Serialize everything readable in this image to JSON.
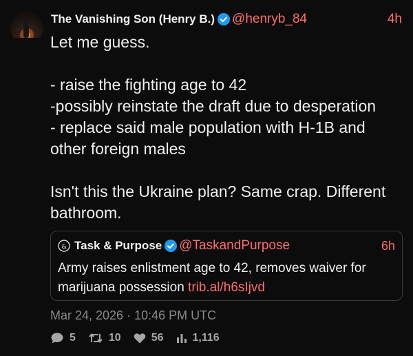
{
  "post": {
    "author_name": "The Vanishing Son (Henry B.)",
    "handle": "@henryb_84",
    "time": "4h",
    "lines": [
      "Let me guess.",
      "",
      "- raise the fighting age to 42",
      "-possibly reinstate the draft due to desperation",
      "- replace said male population with H-1B and other foreign males",
      "",
      "Isn't this the Ukraine plan? Same crap. Different bathroom."
    ],
    "timestamp": "Mar 24, 2026 · 10:46 PM UTC",
    "stats": {
      "replies": "5",
      "reposts": "10",
      "likes": "56",
      "views": "1,116"
    }
  },
  "quoted": {
    "author_name": "Task & Purpose",
    "handle": "@TaskandPurpose",
    "time": "6h",
    "text": "Army raises enlistment age to 42, removes waiver for marijuana possession ",
    "link": "trib.al/h6sIjvd"
  },
  "colors": {
    "background": "#0c0c0c",
    "accent": "#ff6d6d",
    "verified": "#1d9bf0",
    "muted": "#8a8a8a"
  },
  "icons": {
    "verified": "verified-badge-icon",
    "quoted_logo": "task-purpose-logo-icon",
    "reply": "reply-icon",
    "repost": "repost-icon",
    "like": "heart-icon",
    "views": "views-icon"
  }
}
